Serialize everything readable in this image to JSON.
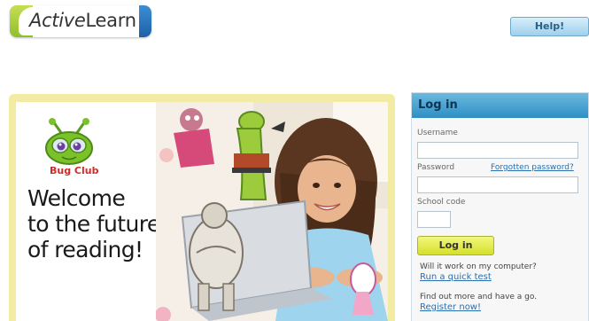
{
  "header": {
    "logo_active": "Active",
    "logo_learn": "Learn",
    "help_label": "Help!"
  },
  "banner": {
    "brand": "Bug Club",
    "welcome_lines": [
      "Welcome",
      "to the future",
      "of reading!"
    ]
  },
  "login": {
    "title": "Log in",
    "username_label": "Username",
    "username_value": "",
    "password_label": "Password",
    "password_value": "",
    "forgot_label": "Forgotten password?",
    "school_code_label": "School code",
    "school_code_value": "",
    "submit_label": "Log in",
    "compat_question": "Will it work on my computer?",
    "quick_test_link": "Run a quick test",
    "find_out_text": "Find out more and have a go.",
    "register_link": "Register now!"
  },
  "colors": {
    "banner_border": "#f1eba3",
    "login_header": "#2f8fc4",
    "login_button": "#d4e02c",
    "bug_club_red": "#d42a2a",
    "link_blue": "#2a6fb0"
  }
}
